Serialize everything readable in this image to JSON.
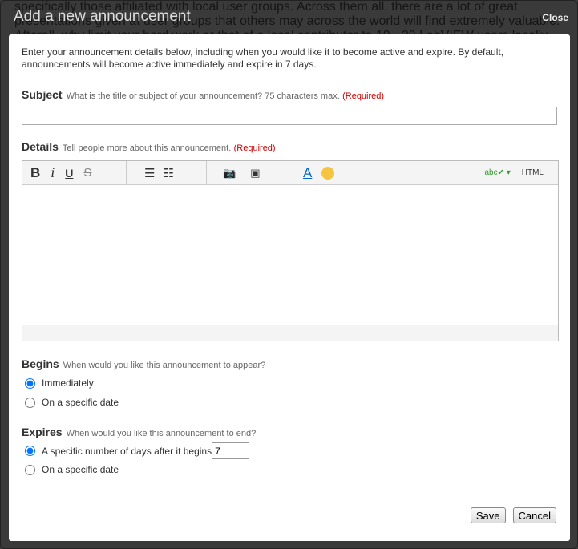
{
  "background_text": "specifically those affiliated with local user groups. Across them all, there are a lot of great presentations given at user groups that others may across the world will find extremely valuable. Afterall, why limit your hard work or that of a local contributor to 10 - 20 LabVIEW users locally when thousands could potentially benefit from the information that have chosen",
  "dialog": {
    "title": "Add a new announcement",
    "close": "Close",
    "intro": "Enter your announcement details below, including when you would like it to become active and expire. By default, announcements will become active immediately and expire in 7 days.",
    "subject": {
      "label": "Subject",
      "hint": "What is the title or subject of your announcement? 75 characters max.",
      "required": "(Required)",
      "value": ""
    },
    "details": {
      "label": "Details",
      "hint": "Tell people more about this announcement.",
      "required": "(Required)",
      "toolbar": {
        "bold": "B",
        "italic": "i",
        "underline": "U",
        "strike": "S",
        "html": "HTML",
        "spell": "abc"
      }
    },
    "begins": {
      "label": "Begins",
      "hint": "When would you like this announcement to appear?",
      "options": [
        "Immediately",
        "On a specific date"
      ],
      "selected": 0
    },
    "expires": {
      "label": "Expires",
      "hint": "When would you like this announcement to end?",
      "options": [
        "A specific number of days after it begins",
        "On a specific date"
      ],
      "selected": 0,
      "days": "7"
    },
    "save": "Save",
    "cancel": "Cancel"
  }
}
